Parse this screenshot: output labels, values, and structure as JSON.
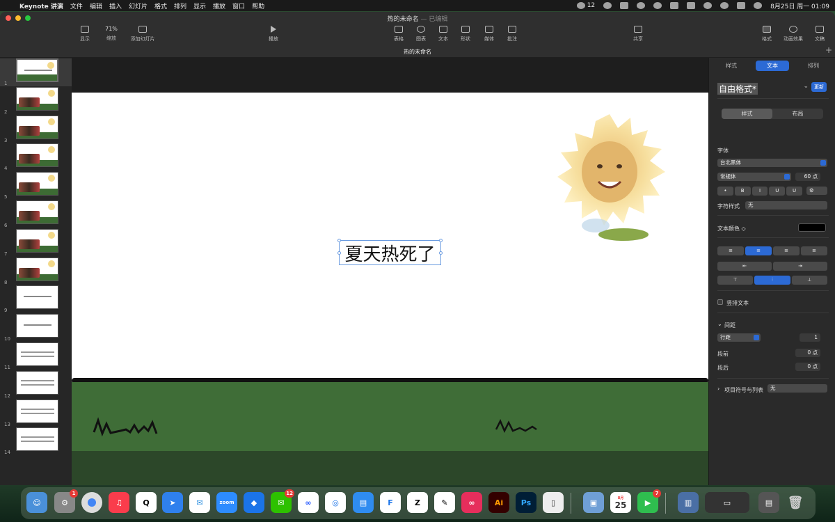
{
  "menubar": {
    "app_name": "Keynote 讲演",
    "menus": [
      "文件",
      "编辑",
      "插入",
      "幻灯片",
      "格式",
      "排列",
      "显示",
      "播放",
      "窗口",
      "帮助"
    ],
    "wechat_count": "12",
    "datetime": "8月25日 周一  01:09"
  },
  "window": {
    "doc_title": "热的未命名",
    "doc_status": "— 已编辑",
    "tab_title": "热的未命名",
    "toolbar": {
      "view_label": "显示",
      "zoom_value": "71%",
      "zoom_label": "缩放",
      "add_slide_label": "添加幻灯片",
      "play_label": "播放",
      "table_label": "表格",
      "chart_label": "图表",
      "text_label": "文本",
      "shape_label": "形状",
      "media_label": "媒体",
      "comment_label": "批注",
      "share_label": "共享",
      "format_label": "格式",
      "animate_label": "动画效果",
      "document_label": "文稿"
    }
  },
  "navigator": {
    "slide_numbers": [
      "1",
      "2",
      "3",
      "4",
      "5",
      "6",
      "7",
      "8",
      "9",
      "10",
      "11",
      "12",
      "13",
      "14"
    ]
  },
  "slide": {
    "title_text": "夏天热死了"
  },
  "inspector": {
    "tabs": [
      "样式",
      "文本",
      "排列"
    ],
    "style_name": "自由格式*",
    "update_label": "更新",
    "subtabs": [
      "样式",
      "布局"
    ],
    "font_section": "字体",
    "font_family": "台北黑体",
    "font_weight": "常规体",
    "font_size": "60 点",
    "bold_label": "B",
    "italic_label": "I",
    "underline_label": "U",
    "strike_label": "U",
    "char_style_label": "字符样式",
    "char_style_value": "无",
    "text_color_label": "文本颜色 ◇",
    "vertical_text_label": "竖排文本",
    "spacing_label": "间距",
    "line_spacing_mode": "行距",
    "line_spacing_value": "1",
    "before_para_label": "段前",
    "before_para_value": "0 点",
    "after_para_label": "段后",
    "after_para_value": "0 点",
    "bullets_label": "项目符号与列表",
    "bullets_value": "无"
  },
  "dock": {
    "settings_badge": "1",
    "wechat_badge": "12",
    "calendar_month": "8月",
    "calendar_day": "25",
    "facetime_badge": "7",
    "zoom_label": "zoom",
    "ai_label": "Ai",
    "ps_label": "Ps"
  }
}
